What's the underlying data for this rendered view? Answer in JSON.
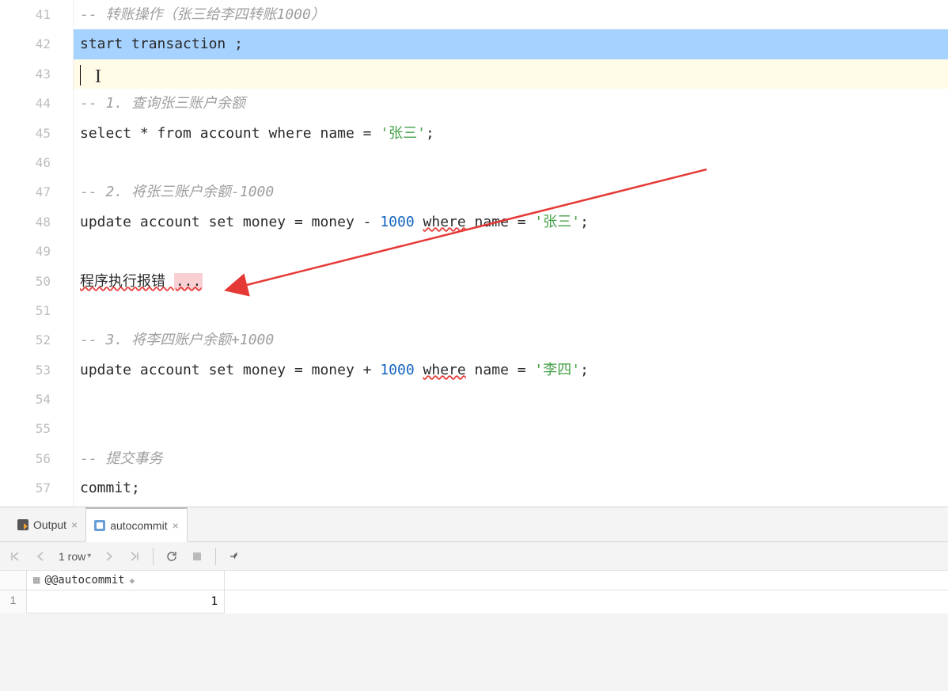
{
  "lines": [
    {
      "num": "41"
    },
    {
      "num": "42"
    },
    {
      "num": "43"
    },
    {
      "num": "44"
    },
    {
      "num": "45"
    },
    {
      "num": "46"
    },
    {
      "num": "47"
    },
    {
      "num": "48"
    },
    {
      "num": "49"
    },
    {
      "num": "50"
    },
    {
      "num": "51"
    },
    {
      "num": "52"
    },
    {
      "num": "53"
    },
    {
      "num": "54"
    },
    {
      "num": "55"
    },
    {
      "num": "56"
    },
    {
      "num": "57"
    }
  ],
  "code": {
    "c41": "-- 转账操作（张三给李四转账1000）",
    "l42_kw1": "start",
    "l42_kw2": "transaction",
    "l42_end": " ;",
    "c44": "-- 1. 查询张三账户余额",
    "l45_kw1": "select",
    "l45_star": " * ",
    "l45_kw2": "from",
    "l45_t": " account ",
    "l45_kw3": "where",
    "l45_c": " name = ",
    "l45_str": "'张三'",
    "l45_end": ";",
    "c47": "-- 2. 将张三账户余额-1000",
    "l48_kw1": "update",
    "l48_t": " account ",
    "l48_kw2": "set",
    "l48_c1": " money = money - ",
    "l48_num": "1000",
    "l48_sp": " ",
    "l48_kw3": "where",
    "l48_c2": " name = ",
    "l48_str": "'张三'",
    "l48_end": ";",
    "l50_txt": "程序执行报错 ",
    "l50_err": "...",
    "c52": "-- 3. 将李四账户余额+1000",
    "l53_kw1": "update",
    "l53_t": " account ",
    "l53_kw2": "set",
    "l53_c1": " money = money + ",
    "l53_num": "1000",
    "l53_sp": " ",
    "l53_kw3": "where",
    "l53_c2": " name = ",
    "l53_str": "'李四'",
    "l53_end": ";",
    "c56": "-- 提交事务",
    "l57_kw": "commit",
    "l57_end": ";"
  },
  "tabs": {
    "output": "Output",
    "autocommit": "autocommit"
  },
  "toolbar": {
    "rows": "1 row"
  },
  "result": {
    "column": "@@autocommit",
    "row1_num": "1",
    "row1_val": "1"
  }
}
